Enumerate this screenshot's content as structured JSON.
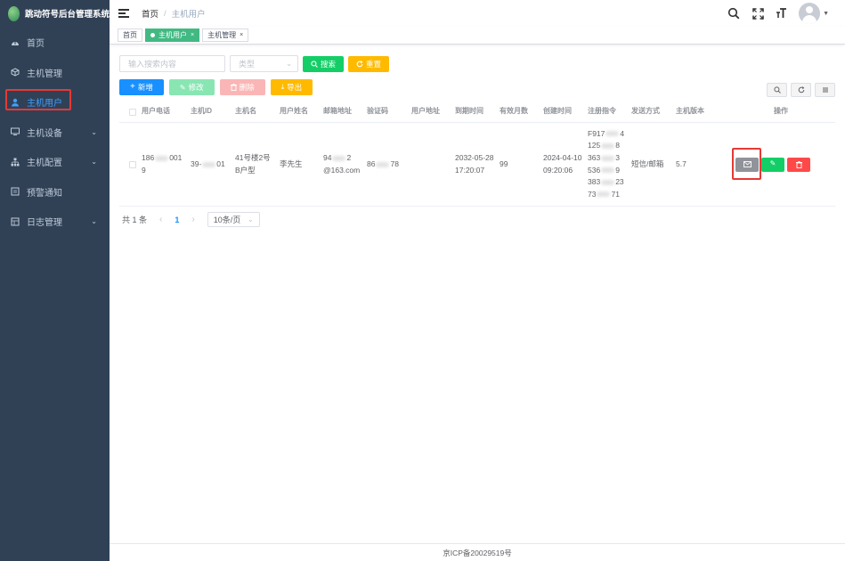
{
  "app": {
    "title": "跳动符号后台管理系统"
  },
  "sidebar": {
    "items": [
      {
        "label": "首页",
        "icon": "dashboard-icon",
        "has_children": false,
        "active": false
      },
      {
        "label": "主机管理",
        "icon": "cube-icon",
        "has_children": false,
        "active": false
      },
      {
        "label": "主机用户",
        "icon": "user-icon",
        "has_children": false,
        "active": true
      },
      {
        "label": "主机设备",
        "icon": "monitor-icon",
        "has_children": true,
        "active": false
      },
      {
        "label": "主机配置",
        "icon": "tree-icon",
        "has_children": true,
        "active": false
      },
      {
        "label": "预警通知",
        "icon": "bell-icon",
        "has_children": false,
        "active": false
      },
      {
        "label": "日志管理",
        "icon": "log-icon",
        "has_children": true,
        "active": false
      }
    ]
  },
  "header": {
    "breadcrumb": {
      "home": "首页",
      "separator": "/",
      "current": "主机用户"
    }
  },
  "tags": [
    {
      "label": "首页",
      "active": false,
      "closable": false
    },
    {
      "label": "主机用户",
      "active": true,
      "closable": true
    },
    {
      "label": "主机管理",
      "active": false,
      "closable": true
    }
  ],
  "search": {
    "keyword_placeholder": "输入搜索内容",
    "type_placeholder": "类型",
    "search_label": "搜索",
    "reset_label": "重置"
  },
  "toolbar": {
    "add_label": "新增",
    "edit_label": "修改",
    "delete_label": "删除",
    "export_label": "导出"
  },
  "table": {
    "columns": [
      "用户电话",
      "主机ID",
      "主机名",
      "用户姓名",
      "邮箱地址",
      "验证码",
      "用户地址",
      "到期时间",
      "有效月数",
      "创建时间",
      "注册指令",
      "发送方式",
      "主机版本",
      "操作"
    ],
    "rows": [
      {
        "phone_pre": "186",
        "phone_suf": "001",
        "phone_line2": "9",
        "host_id_pre": "39-",
        "host_id_suf": "01",
        "host_name_line1": "41号楼2号",
        "host_name_line2": "B户型",
        "user_name": "李先生",
        "email_pre": "94",
        "email_suf": "2",
        "email_line2": "@163.com",
        "code_pre": "86",
        "code_suf": "78",
        "address": "",
        "expire_date": "2032-05-28",
        "expire_time": "17:20:07",
        "months": "99",
        "created_date": "2024-04-10",
        "created_time": "09:20:06",
        "cmd": [
          {
            "pre": "F917",
            "suf": "4"
          },
          {
            "pre": "125",
            "suf": "8"
          },
          {
            "pre": "363",
            "suf": "3"
          },
          {
            "pre": "536",
            "suf": "9"
          },
          {
            "pre": "383",
            "suf": "23"
          },
          {
            "pre": "73",
            "suf": "71"
          }
        ],
        "send_method": "短信/邮箱",
        "version": "5.7"
      }
    ]
  },
  "pagination": {
    "total_text": "共 1 条",
    "prev": "‹",
    "current_page": "1",
    "next": "›",
    "page_size": "10条/页"
  },
  "footer": {
    "icp": "京ICP备20029519号"
  },
  "colors": {
    "sidebar_bg": "#304156",
    "primary": "#1890ff",
    "success": "#13ce66",
    "warning": "#ffba00",
    "danger": "#ff4949",
    "tag_active": "#42b983",
    "highlight": "#e53935"
  }
}
